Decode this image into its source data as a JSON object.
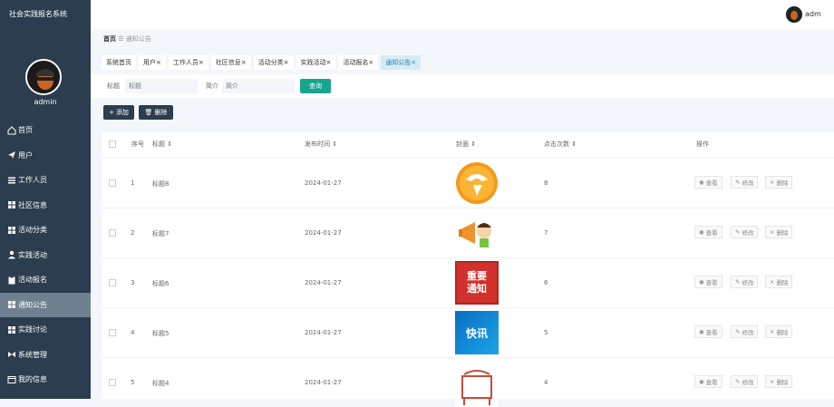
{
  "app": {
    "title": "社会实践报名系统",
    "user": "admin",
    "top_user": "adm"
  },
  "sidebar": {
    "items": [
      {
        "label": "首页",
        "icon": "home-icon"
      },
      {
        "label": "用户",
        "icon": "send-icon"
      },
      {
        "label": "工作人员",
        "icon": "list-icon"
      },
      {
        "label": "社区信息",
        "icon": "grid-icon"
      },
      {
        "label": "活动分类",
        "icon": "grid-icon"
      },
      {
        "label": "实践活动",
        "icon": "person-icon"
      },
      {
        "label": "活动报名",
        "icon": "clipboard-icon"
      },
      {
        "label": "通知公告",
        "icon": "grid-icon"
      },
      {
        "label": "实践讨论",
        "icon": "grid-icon"
      },
      {
        "label": "系统管理",
        "icon": "bowtie-icon"
      },
      {
        "label": "我的信息",
        "icon": "window-icon"
      }
    ],
    "active": "通知公告"
  },
  "breadcrumb": {
    "home": "首页",
    "separator": "☰",
    "current": "通知公告"
  },
  "tabs": [
    {
      "label": "系统首页",
      "closable": false
    },
    {
      "label": "用户",
      "closable": true
    },
    {
      "label": "工作人员",
      "closable": true
    },
    {
      "label": "社区信息",
      "closable": true
    },
    {
      "label": "活动分类",
      "closable": true
    },
    {
      "label": "实践活动",
      "closable": true
    },
    {
      "label": "活动报名",
      "closable": true
    },
    {
      "label": "通知公告",
      "closable": true,
      "active": true
    }
  ],
  "search": {
    "title_label": "标题",
    "title_placeholder": "标题",
    "intro_label": "简介",
    "intro_placeholder": "简介",
    "search_button": "查询"
  },
  "actions": {
    "add": "添加",
    "delete": "删除"
  },
  "table": {
    "headers": {
      "index": "序号",
      "title": "标题 ⇕",
      "time": "发布时间 ⇕",
      "cover": "封面 ⇕",
      "clicks": "点击次数 ⇕",
      "ops": "操作"
    },
    "row_actions": {
      "view": "查看",
      "edit": "修改",
      "delete": "删除"
    },
    "rows": [
      {
        "index": "1",
        "title": "标题8",
        "time": "2024-01-27",
        "clicks": "8",
        "cover": "orange-mascot"
      },
      {
        "index": "2",
        "title": "标题7",
        "time": "2024-01-27",
        "clicks": "7",
        "cover": "megaphone-kid"
      },
      {
        "index": "3",
        "title": "标题6",
        "time": "2024-01-27",
        "clicks": "6",
        "cover": "important-notice",
        "cover_text": [
          "重要",
          "通知"
        ]
      },
      {
        "index": "4",
        "title": "标题5",
        "time": "2024-01-27",
        "clicks": "5",
        "cover": "news-flash",
        "cover_text": [
          "快讯"
        ]
      },
      {
        "index": "5",
        "title": "标题4",
        "time": "2024-01-27",
        "clicks": "4",
        "cover": "notice-board"
      }
    ]
  },
  "colors": {
    "sidebar": "#2b3d4f",
    "active_menu": "#6f8191",
    "search_button": "#17a58f",
    "active_tab": "#d6ecf5"
  }
}
